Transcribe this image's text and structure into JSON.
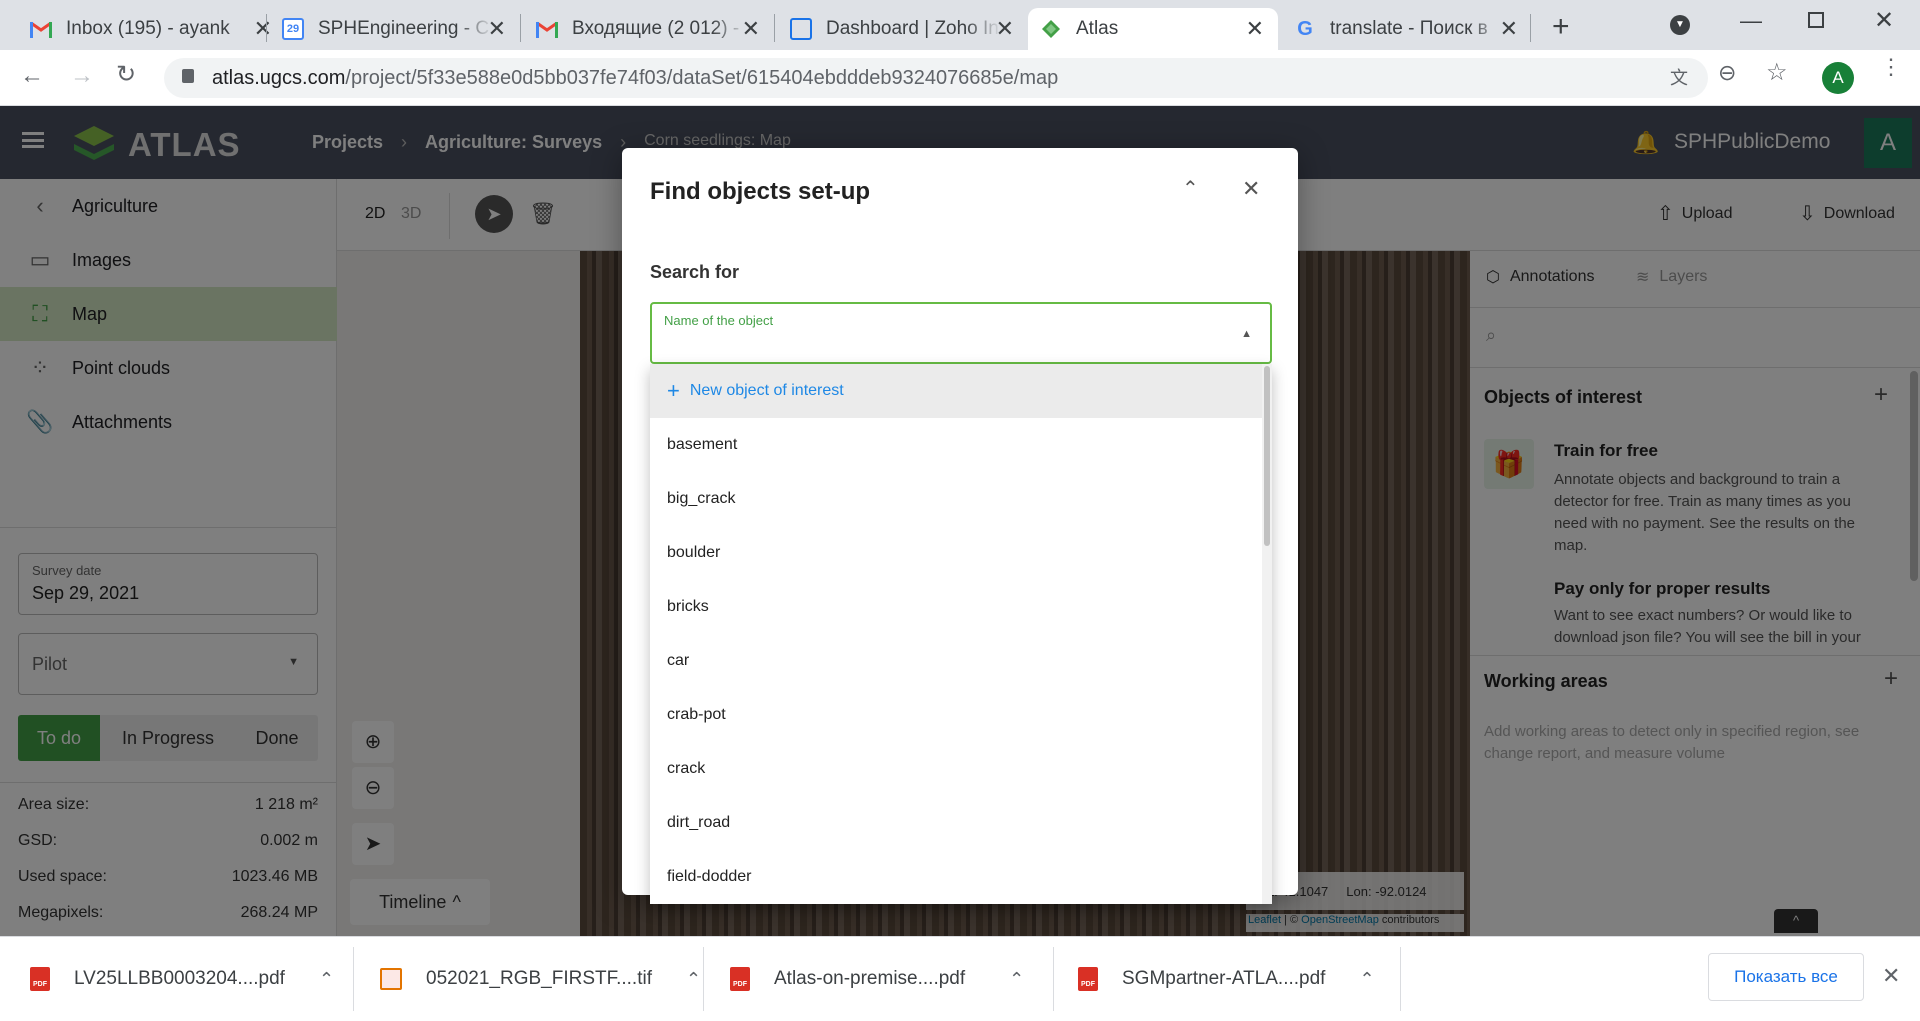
{
  "browser": {
    "tabs": [
      {
        "title": "Inbox (195) - ayank",
        "favicon": "gmail-icon",
        "active": false
      },
      {
        "title": "SPHEngineering - C",
        "favicon": "calendar-icon",
        "active": false
      },
      {
        "title": "Входящие (2 012) -",
        "favicon": "gmail-icon",
        "active": false
      },
      {
        "title": "Dashboard | Zoho In",
        "favicon": "zoho-icon",
        "active": false
      },
      {
        "title": "Atlas",
        "favicon": "atlas-icon",
        "active": true
      },
      {
        "title": "translate - Поиск в",
        "favicon": "google-icon",
        "active": false
      }
    ],
    "calendar_day": "29",
    "url_host": "atlas.ugcs.com",
    "url_path": "/project/5f33e588e0d5bb037fe74f03/dataSet/615404ebdddeb9324076685e/map",
    "profile_initial": "A"
  },
  "app": {
    "logo": "ATLAS",
    "breadcrumb": [
      "Projects",
      "Agriculture: Surveys",
      "Corn seedlings: Map"
    ],
    "account_name": "SPHPublicDemo",
    "account_initial": "A",
    "brand_color": "#4caf50"
  },
  "sidebar": {
    "back_label": "Agriculture",
    "items": [
      {
        "label": "Images",
        "icon": "images-icon"
      },
      {
        "label": "Map",
        "icon": "map-icon",
        "active": true
      },
      {
        "label": "Point clouds",
        "icon": "point-cloud-icon"
      },
      {
        "label": "Attachments",
        "icon": "paperclip-icon"
      }
    ],
    "survey_date_label": "Survey date",
    "survey_date_value": "Sep 29, 2021",
    "pilot_placeholder": "Pilot",
    "status_buttons": [
      "To do",
      "In Progress",
      "Done"
    ],
    "stats": [
      {
        "label": "Area size:",
        "value": "1 218 m²"
      },
      {
        "label": "GSD:",
        "value": "0.002 m"
      },
      {
        "label": "Used space:",
        "value": "1023.46 MB"
      },
      {
        "label": "Megapixels:",
        "value": "268.24 MP"
      }
    ]
  },
  "toolbar": {
    "mode_2d": "2D",
    "mode_3d": "3D",
    "upload_label": "Upload",
    "download_label": "Download"
  },
  "map": {
    "timeline_label": "Timeline",
    "lat_label": "Lat: 41.1047",
    "lon_label": "Lon: -92.0124",
    "attribution_leaflet": "Leaflet",
    "attribution_sep": " | © ",
    "attribution_osm": "OpenStreetMap",
    "attribution_contrib": " contributors"
  },
  "right_panel": {
    "tabs": [
      "Annotations",
      "Layers"
    ],
    "objects_title": "Objects of interest",
    "train_title": "Train for free",
    "train_text": "Annotate objects and background to train a detector for free. Train as many times as you need with no payment. See the results on the map.",
    "pay_title": "Pay only for proper results",
    "pay_text": "Want to see exact numbers? Or would like to download json file? You will see the bill in your",
    "working_title": "Working areas",
    "working_text": "Add working areas to detect only in specified region, see change report, and measure volume"
  },
  "modal": {
    "title": "Find objects set-up",
    "search_for_label": "Search for",
    "field_label": "Name of the object",
    "new_option": "New object of interest",
    "options": [
      "basement",
      "big_crack",
      "boulder",
      "bricks",
      "car",
      "crab-pot",
      "crack",
      "dirt_road",
      "field-dodder"
    ]
  },
  "downloads": {
    "items": [
      {
        "name": "LV25LLBB0003204....pdf",
        "type": "pdf"
      },
      {
        "name": "052021_RGB_FIRSTF....tif",
        "type": "tif"
      },
      {
        "name": "Atlas-on-premise....pdf",
        "type": "pdf"
      },
      {
        "name": "SGMpartner-ATLA....pdf",
        "type": "pdf"
      }
    ],
    "show_all": "Показать все",
    "pdf_badge": "PDF"
  }
}
